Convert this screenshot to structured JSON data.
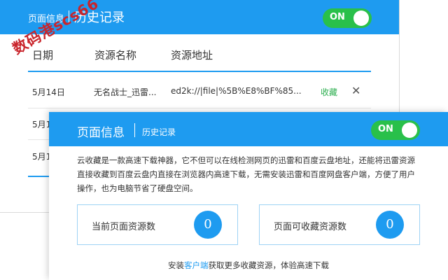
{
  "back": {
    "tab_page_info": "页面信息",
    "tab_history": "历史记录",
    "toggle_label": "ON",
    "columns": [
      "日期",
      "资源名称",
      "资源地址"
    ],
    "rows": [
      {
        "date": "5月14日",
        "name": "无名战士_迅雷...",
        "address": "ed2k://|file|%5B%E8%BF%85...",
        "action": "收藏",
        "close": "✕"
      },
      {
        "date": "5月1",
        "name": "",
        "address": "",
        "action": "",
        "close": ""
      },
      {
        "date": "5月1",
        "name": "",
        "address": "",
        "action": "",
        "close": ""
      }
    ]
  },
  "watermark": "数码港scs66",
  "front": {
    "tab_page_info": "页面信息",
    "tab_history": "历史记录",
    "toggle_label": "ON",
    "description": "云收藏是一款高速下载神器，它不但可以在线检测网页的迅雷和百度云盘地址，还能将迅雷资源直接收藏到百度云盘内直接在浏览器内高速下载，无需安装迅雷和百度网盘客户端，方便了用户操作，也为电脑节省了硬盘空间。",
    "stat_current_label": "当前页面资源数",
    "stat_current_value": "0",
    "stat_collectable_label": "页面可收藏资源数",
    "stat_collectable_value": "0",
    "footer_prefix": "安装",
    "footer_link": "客户端",
    "footer_suffix": "获取更多收藏资源，体验高速下载"
  },
  "colors": {
    "accent": "#1e9bf0",
    "toggle_on": "#29c04a",
    "favorite": "#2bae4e"
  }
}
